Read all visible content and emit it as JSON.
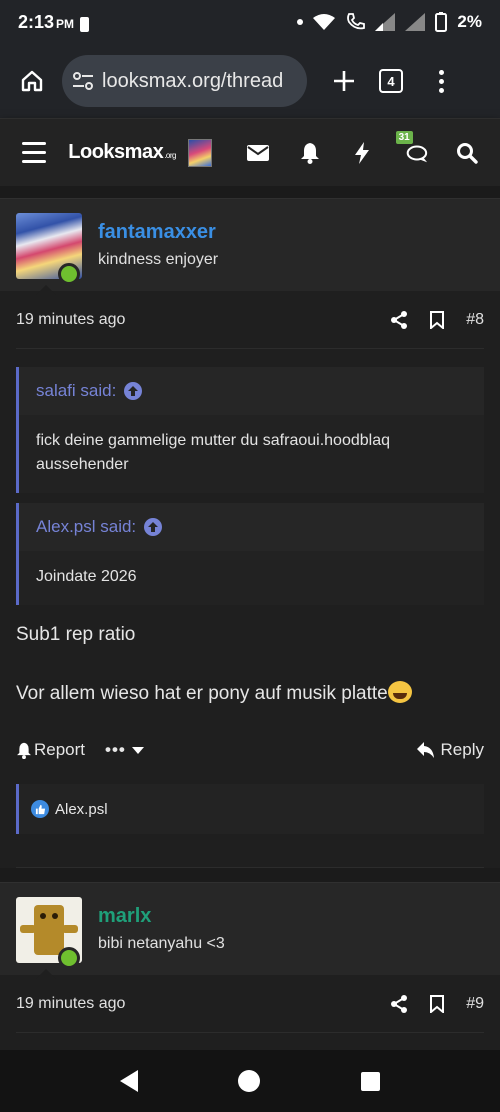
{
  "status_bar": {
    "time": "2:13",
    "ampm": "PM",
    "battery": "2%"
  },
  "browser": {
    "url": "looksmax.org/thread",
    "tab_count": "4"
  },
  "site_nav": {
    "logo": "Looksmax",
    "logo_suffix": ".org",
    "notifications_badge": "31"
  },
  "posts": [
    {
      "username": "fantamaxxer",
      "username_color": "#3a8fe4",
      "user_title": "kindness enjoyer",
      "time": "19 minutes ago",
      "post_number": "#8",
      "quotes": [
        {
          "author": "salafi said:",
          "text": "fick deine gammelige mutter du safraoui.hoodblaq aussehender"
        },
        {
          "author": "Alex.psl said:",
          "text": "Joindate 2026"
        }
      ],
      "message": [
        "Sub1 rep ratio",
        "Vor allem wieso hat er pony auf musik platte"
      ],
      "report_label": "Report",
      "reply_label": "Reply",
      "reaction_user": "Alex.psl"
    },
    {
      "username": "marlx",
      "username_color": "#1fa07a",
      "user_title": "bibi netanyahu <3",
      "time": "19 minutes ago",
      "post_number": "#9"
    }
  ],
  "icons": {
    "home": "home-icon",
    "site_settings": "tune-icon",
    "new_tab": "plus-icon",
    "tabs": "tabs-icon",
    "menu": "more-vert-icon",
    "hamburger": "hamburger-icon",
    "mail": "envelope-icon",
    "bell": "bell-icon",
    "bolt": "bolt-icon",
    "chat": "chat-icon",
    "search": "search-icon",
    "share": "share-icon",
    "bookmark": "bookmark-icon",
    "quote_jump": "arrow-up-circle-icon",
    "like": "like-icon"
  }
}
